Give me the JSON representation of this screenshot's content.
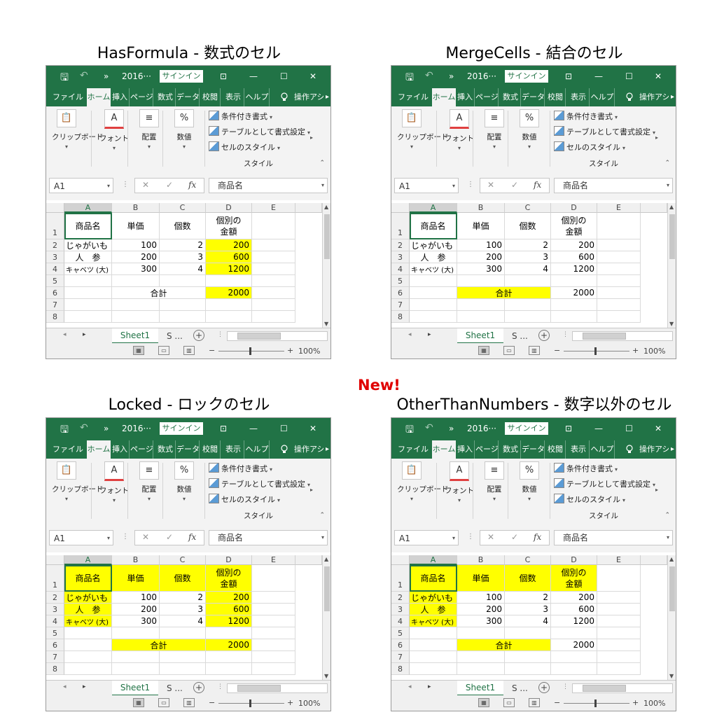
{
  "new_badge": "New!",
  "colors": {
    "excel_green": "#217346",
    "highlight_yellow": "#ffff00",
    "new_red": "#e00000"
  },
  "ui": {
    "save_icon": "save-icon",
    "undo_icon": "undo-icon",
    "more_qat": "»",
    "filename": "2016···",
    "signin": "サインイン",
    "window_icons": [
      "ribbon-display-icon",
      "minimize-icon",
      "maximize-icon",
      "close-icon"
    ],
    "tabs": [
      "ファイル",
      "ホーム",
      "挿入",
      "ページ",
      "数式",
      "データ",
      "校閲",
      "表示",
      "ヘルプ",
      "操作アシ"
    ],
    "ribbon": {
      "clipboard": "クリップボード",
      "font": "フォント",
      "alignment": "配置",
      "number": "数値",
      "cond_format": "条件付き書式",
      "table_format": "テーブルとして書式設定",
      "cell_style": "セルのスタイル",
      "styles_group": "スタイル"
    },
    "namebox": "A1",
    "fx": "fx",
    "formula": "商品名",
    "columns": [
      "A",
      "B",
      "C",
      "D",
      "E"
    ],
    "rows": [
      "1",
      "2",
      "3",
      "4",
      "5",
      "6",
      "7",
      "8"
    ],
    "sheet1": "Sheet1",
    "sheet2": "S ...",
    "add_sheet": "+",
    "zoom": "100%",
    "zoom_minus": "−",
    "zoom_plus": "+"
  },
  "table": {
    "h_name": "商品名",
    "h_price": "単価",
    "h_qty": "個数",
    "h_amount1": "個別の",
    "h_amount2": "金額",
    "r2": [
      "じゃがいも",
      "100",
      "2",
      "200"
    ],
    "r3": [
      "人　参",
      "200",
      "3",
      "600"
    ],
    "r4": [
      "キャベツ (大)",
      "300",
      "4",
      "1200"
    ],
    "total_label": "合計",
    "total_value": "2000"
  },
  "panels": [
    {
      "id": "hasformula",
      "title": "HasFormula - 数式のセル",
      "highlight": [
        "D2",
        "D3",
        "D4",
        "D6"
      ]
    },
    {
      "id": "mergecells",
      "title": "MergeCells - 結合のセル",
      "highlight": [
        "B6"
      ]
    },
    {
      "id": "locked",
      "title": "Locked - ロックのセル",
      "highlight": [
        "A1",
        "B1",
        "C1",
        "D1",
        "A2",
        "A3",
        "A4",
        "B6",
        "D2",
        "D3",
        "D4",
        "D6"
      ]
    },
    {
      "id": "otherthannumbers",
      "title": "OtherThanNumbers - 数字以外のセル",
      "highlight": [
        "A1",
        "B1",
        "C1",
        "D1",
        "A2",
        "A3",
        "A4",
        "B6"
      ]
    }
  ]
}
